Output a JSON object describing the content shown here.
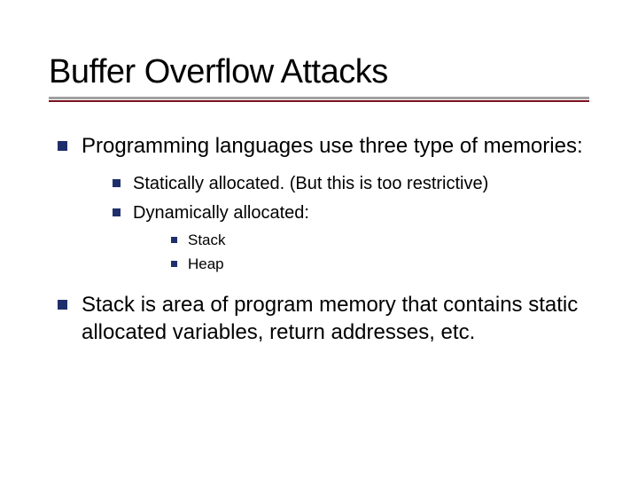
{
  "title": "Buffer Overflow Attacks",
  "bullets": {
    "b1": "Programming languages use three type of memories:",
    "b1a": "Statically allocated. (But this is too restrictive)",
    "b1b": "Dynamically allocated:",
    "b1b1": "Stack",
    "b1b2": "Heap",
    "b2": "Stack is area of program memory that contains static allocated variables, return addresses, etc."
  }
}
